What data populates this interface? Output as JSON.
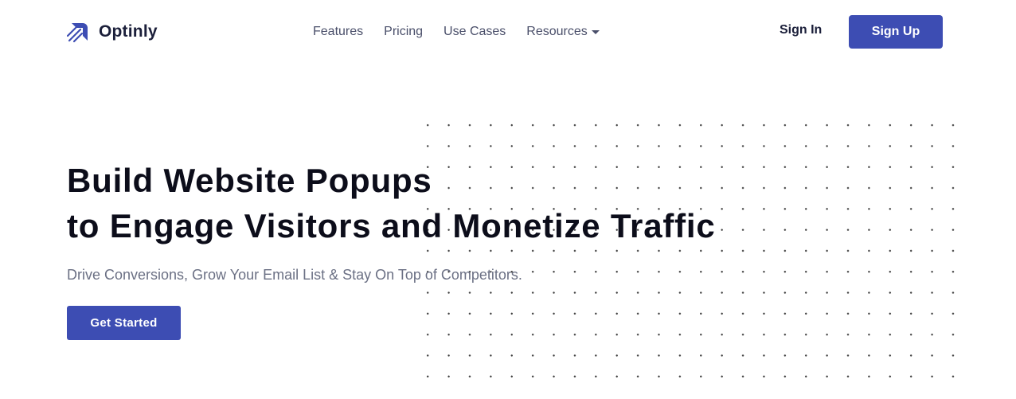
{
  "brand": {
    "name": "Optinly",
    "logo_icon": "optinly-logo-icon",
    "color": "#3d4db3"
  },
  "nav": {
    "links": [
      {
        "label": "Features"
      },
      {
        "label": "Pricing"
      },
      {
        "label": "Use Cases"
      },
      {
        "label": "Resources",
        "icon": "caret-down-icon"
      }
    ]
  },
  "auth": {
    "sign_in": "Sign In",
    "sign_up": "Sign Up"
  },
  "hero": {
    "title_line1": "Build Website Popups",
    "title_line2": "to Engage Visitors and Monetize Traffic",
    "subtitle": "Drive Conversions, Grow Your Email List & Stay On Top of Competitors.",
    "cta": "Get Started"
  },
  "colors": {
    "accent": "#3d4db3",
    "heading": "#0c0d1a",
    "muted": "#6b7084"
  }
}
